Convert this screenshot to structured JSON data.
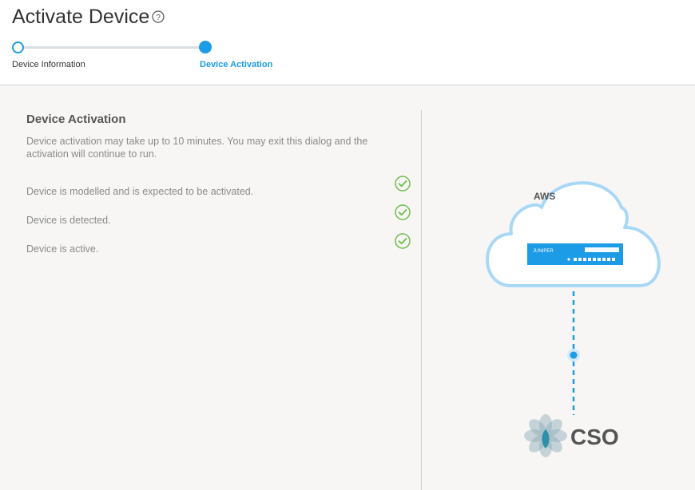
{
  "header": {
    "title": "Activate Device",
    "steps": [
      {
        "label": "Device Information"
      },
      {
        "label": "Device Activation"
      }
    ]
  },
  "main": {
    "section_title": "Device Activation",
    "description": "Device activation may take up to 10 minutes. You may exit this dialog and the activation will continue to run.",
    "statuses": [
      {
        "text": "Device is modelled and is expected to be activated.",
        "icon": "check-circle-icon"
      },
      {
        "text": "Device is detected.",
        "icon": "check-circle-icon"
      },
      {
        "text": "Device is active.",
        "icon": "check-circle-icon"
      }
    ]
  },
  "diagram": {
    "cloud_label": "AWS",
    "device_brand": "JUNIPER",
    "bottom_label": "CSO"
  },
  "colors": {
    "accent": "#1c9be6",
    "cloud": "#a9d8f7",
    "check": "#6cbf4a",
    "text_muted": "#8a8a8a"
  }
}
